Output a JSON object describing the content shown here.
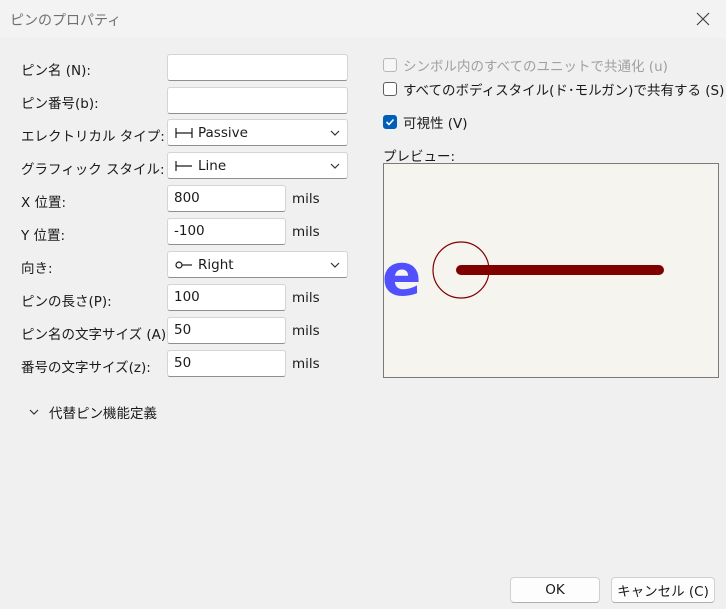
{
  "window": {
    "title": "ピンのプロパティ"
  },
  "fields": {
    "pin_name": {
      "label": "ピン名 (N):",
      "value": ""
    },
    "pin_number": {
      "label": "ピン番号(b):",
      "value": ""
    },
    "electrical_type": {
      "label": "エレクトリカル タイプ:",
      "value": "Passive",
      "icon": "passive-pin-glyph"
    },
    "graphic_style": {
      "label": "グラフィック スタイル:",
      "value": "Line",
      "icon": "line-pin-glyph"
    },
    "x_position": {
      "label": "X 位置:",
      "value": "800",
      "unit": "mils"
    },
    "y_position": {
      "label": "Y 位置:",
      "value": "-100",
      "unit": "mils"
    },
    "orientation": {
      "label": "向き:",
      "value": "Right",
      "icon": "right-pin-glyph"
    },
    "pin_length": {
      "label": "ピンの長さ(P):",
      "value": "100",
      "unit": "mils"
    },
    "name_text_size": {
      "label": "ピン名の文字サイズ (A):",
      "value": "50",
      "unit": "mils"
    },
    "number_text_size": {
      "label": "番号の文字サイズ(z):",
      "value": "50",
      "unit": "mils"
    }
  },
  "options": {
    "common_to_all_units": {
      "label": "シンボル内のすべてのユニットで共通化 (u)",
      "checked": false,
      "enabled": false
    },
    "common_to_all_body_styles": {
      "label": "すべてのボディスタイル(ド･モルガン)で共有する (S)",
      "checked": false,
      "enabled": true
    },
    "visible": {
      "label": "可視性 (V)",
      "checked": true,
      "enabled": true
    }
  },
  "preview": {
    "label": "プレビュー:",
    "pin_color": "#800000",
    "text_color": "#5050ff",
    "background_color": "#f5f4ef",
    "visible_glyph": "e"
  },
  "alternates": {
    "label": "代替ピン機能定義",
    "expanded": false
  },
  "buttons": {
    "ok": "OK",
    "cancel": "キャンセル (C)"
  }
}
